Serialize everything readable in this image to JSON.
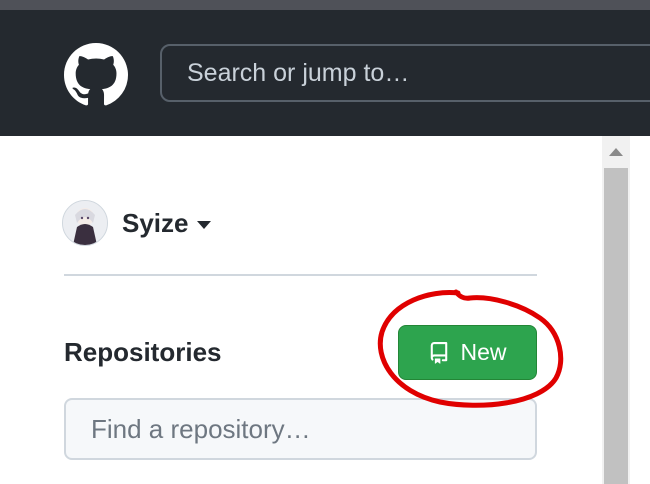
{
  "header": {
    "logo": "github-octocat-icon",
    "search_placeholder": "Search or jump to…"
  },
  "user": {
    "name": "Syize",
    "avatar": "user-avatar",
    "menu_icon": "caret-down-icon"
  },
  "repositories": {
    "heading": "Repositories",
    "new_button_label": "New",
    "new_button_icon": "repo-icon",
    "find_placeholder": "Find a repository…"
  },
  "colors": {
    "header_bg": "#24292f",
    "button_green": "#2da44e",
    "annotation_red": "#e00000"
  }
}
